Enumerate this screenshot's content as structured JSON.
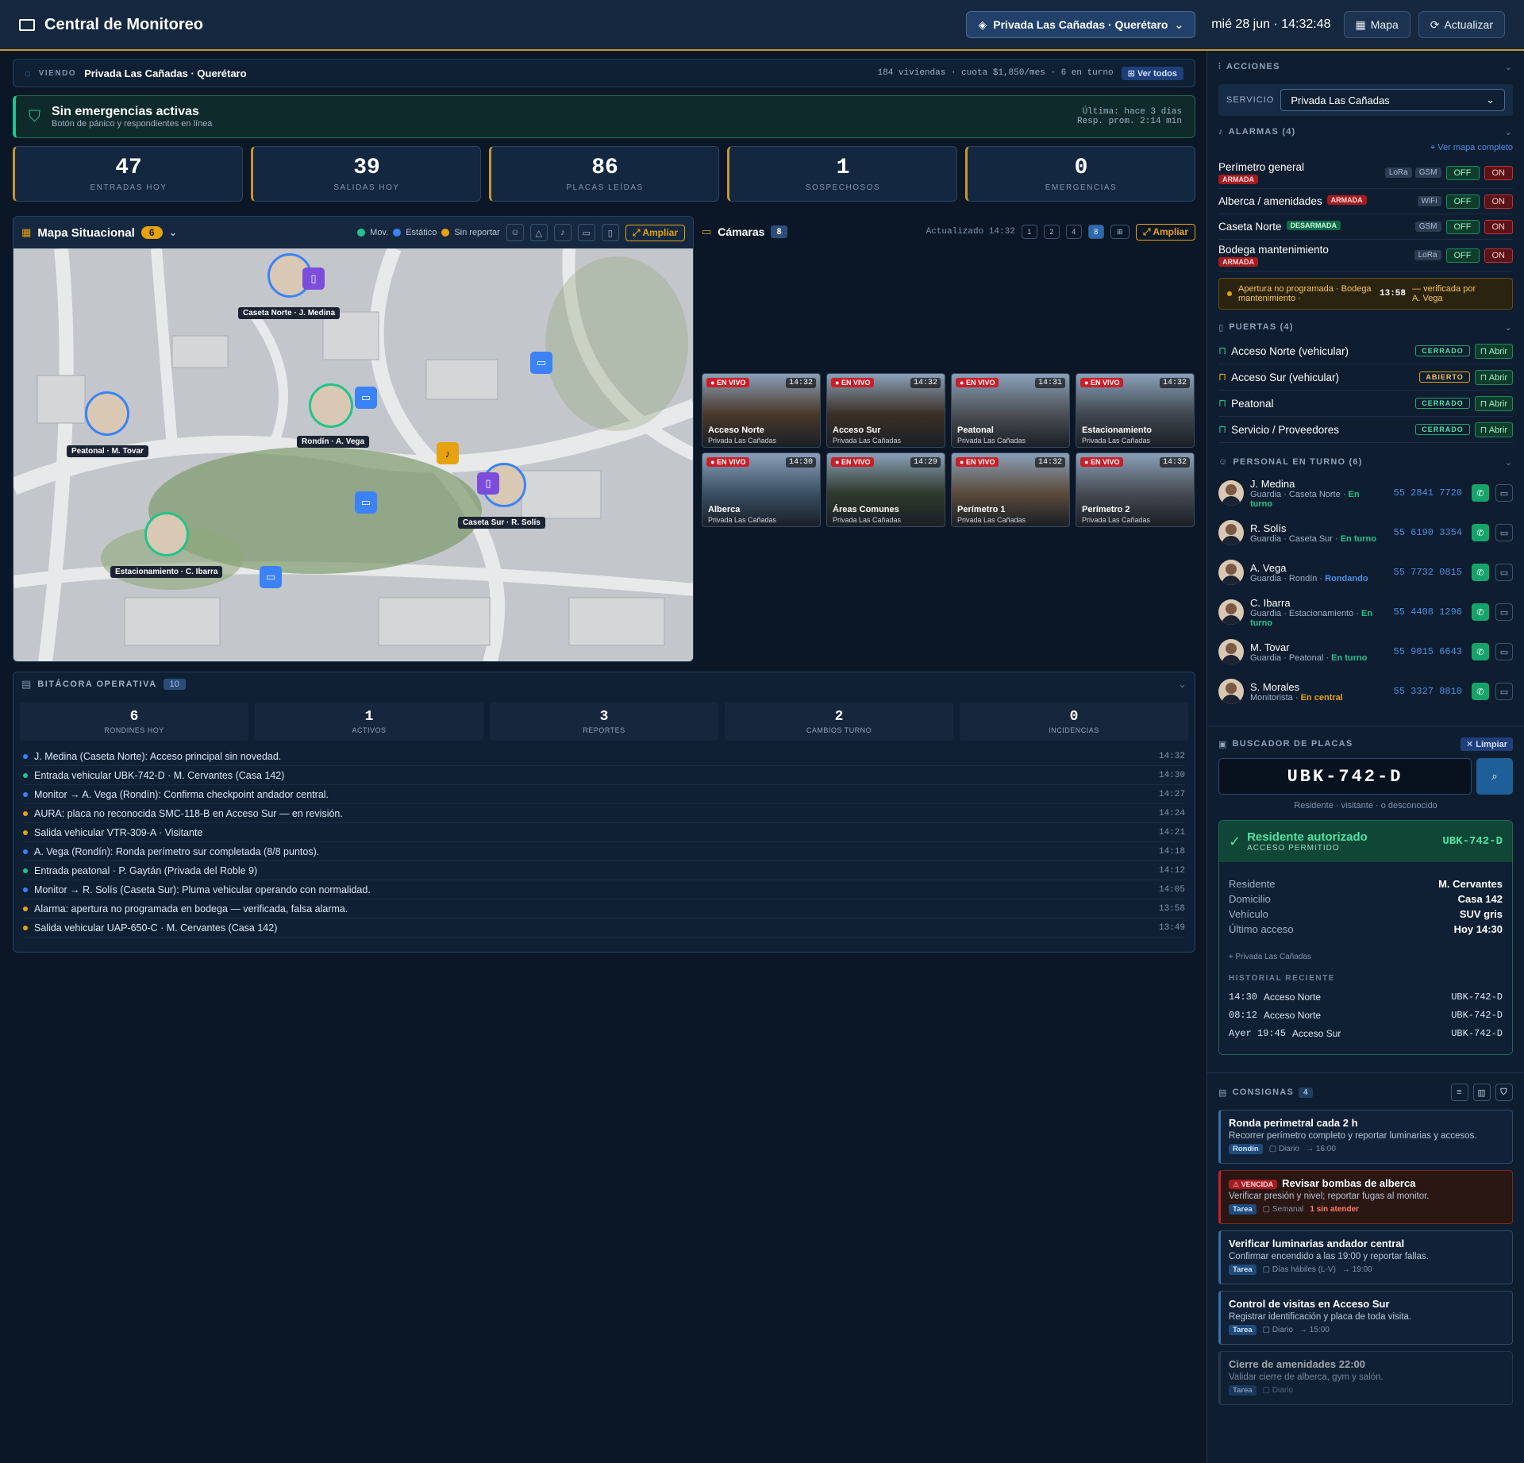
{
  "app": {
    "title": "Central de Monitoreo",
    "site_selector": "Privada Las Cañadas · Querétaro",
    "datetime": "mié 28 jun · 14:32:48",
    "map_button": "Mapa",
    "refresh_button": "Actualizar"
  },
  "viendo": {
    "label": "VIENDO",
    "site": "Privada Las Cañadas · Querétaro",
    "info": "184 viviendas · cuota $1,850/mes · 6 en turno",
    "ver_todos": "Ver todos"
  },
  "emergency": {
    "title": "Sin emergencias activas",
    "subtitle": "Botón de pánico y respondientes en línea",
    "last": "Última: hace 3 días",
    "resp": "Resp. prom. 2:14 min"
  },
  "stats": [
    {
      "value": "47",
      "label": "ENTRADAS HOY"
    },
    {
      "value": "39",
      "label": "SALIDAS HOY"
    },
    {
      "value": "86",
      "label": "PLACAS LEÍDAS"
    },
    {
      "value": "1",
      "label": "SOSPECHOSOS"
    },
    {
      "value": "0",
      "label": "EMERGENCIAS"
    }
  ],
  "map": {
    "title": "Mapa Situacional",
    "count": "6",
    "legend": [
      "Mov.",
      "Estático",
      "Sin reportar"
    ],
    "ampliar": "Ampliar",
    "markers": [
      "Caseta Norte · J. Medina",
      "Peatonal · M. Tovar",
      "Rondín · A. Vega",
      "Caseta Sur · R. Solís",
      "Estacionamiento · C. Ibarra"
    ]
  },
  "cameras": {
    "title": "Cámaras",
    "count": "8",
    "updated": "Actualizado 14:32",
    "layouts": [
      "1",
      "2",
      "4",
      "8",
      "⊞"
    ],
    "ampliar": "Ampliar",
    "live": "EN VIVO",
    "items": [
      {
        "name": "Acceso Norte",
        "site": "Privada Las Cañadas",
        "time": "14:32"
      },
      {
        "name": "Acceso Sur",
        "site": "Privada Las Cañadas",
        "time": "14:32"
      },
      {
        "name": "Peatonal",
        "site": "Privada Las Cañadas",
        "time": "14:31"
      },
      {
        "name": "Estacionamiento",
        "site": "Privada Las Cañadas",
        "time": "14:32"
      },
      {
        "name": "Alberca",
        "site": "Privada Las Cañadas",
        "time": "14:30"
      },
      {
        "name": "Áreas Comunes",
        "site": "Privada Las Cañadas",
        "time": "14:29"
      },
      {
        "name": "Perímetro 1",
        "site": "Privada Las Cañadas",
        "time": "14:32"
      },
      {
        "name": "Perímetro 2",
        "site": "Privada Las Cañadas",
        "time": "14:32"
      }
    ]
  },
  "bitacora": {
    "title": "BITÁCORA OPERATIVA",
    "count": "10",
    "stats": [
      {
        "value": "6",
        "label": "RONDINES HOY"
      },
      {
        "value": "1",
        "label": "ACTIVOS"
      },
      {
        "value": "3",
        "label": "REPORTES"
      },
      {
        "value": "2",
        "label": "CAMBIOS TURNO"
      },
      {
        "value": "0",
        "label": "INCIDENCIAS"
      }
    ],
    "entries": [
      {
        "text": "J. Medina (Caseta Norte): Acceso principal sin novedad.",
        "time": "14:32",
        "color": "#3b82f6"
      },
      {
        "text": "Entrada vehicular UBK-742-D · M. Cervantes (Casa 142)",
        "time": "14:30",
        "color": "#22c38a"
      },
      {
        "text": "Monitor → A. Vega (Rondín): Confirma checkpoint andador central.",
        "time": "14:27",
        "color": "#3b82f6"
      },
      {
        "text": "AURA: placa no reconocida SMC-118-B en Acceso Sur — en revisión.",
        "time": "14:24",
        "color": "#e6a20f"
      },
      {
        "text": "Salida vehicular VTR-309-A · Visitante",
        "time": "14:21",
        "color": "#e6a20f"
      },
      {
        "text": "A. Vega (Rondín): Ronda perímetro sur completada (8/8 puntos).",
        "time": "14:18",
        "color": "#3b82f6"
      },
      {
        "text": "Entrada peatonal · P. Gaytán (Privada del Roble 9)",
        "time": "14:12",
        "color": "#22c38a"
      },
      {
        "text": "Monitor → R. Solís (Caseta Sur): Pluma vehicular operando con normalidad.",
        "time": "14:05",
        "color": "#3b82f6"
      },
      {
        "text": "Alarma: apertura no programada en bodega — verificada, falsa alarma.",
        "time": "13:58",
        "color": "#e6a20f"
      },
      {
        "text": "Salida vehicular UAP-650-C · M. Cervantes (Casa 142)",
        "time": "13:49",
        "color": "#e6a20f"
      }
    ]
  },
  "actions": {
    "title": "ACCIONES",
    "service_label": "SERVICIO",
    "service_value": "Privada Las Cañadas"
  },
  "alarms": {
    "title": "ALARMAS (4)",
    "map_link": "Ver mapa completo",
    "off": "OFF",
    "on": "ON",
    "items": [
      {
        "name": "Perímetro general",
        "state": "ARMADA",
        "chips": [
          "LoRa",
          "GSM"
        ]
      },
      {
        "name": "Alberca / amenidades",
        "state": "ARMADA",
        "chips": [
          "WiFi"
        ]
      },
      {
        "name": "Caseta Norte",
        "state": "DESARMADA",
        "chips": [
          "GSM"
        ]
      },
      {
        "name": "Bodega mantenimiento",
        "state": "ARMADA",
        "chips": [
          "LoRa"
        ]
      }
    ],
    "notice": "Apertura no programada · Bodega mantenimiento ·",
    "notice_time": "13:58",
    "notice_right": "— verificada por A. Vega"
  },
  "doors": {
    "title": "PUERTAS (4)",
    "open_label": "Abrir",
    "items": [
      {
        "name": "Acceso Norte (vehicular)",
        "state": "CERRADO"
      },
      {
        "name": "Acceso Sur (vehicular)",
        "state": "ABIERTO"
      },
      {
        "name": "Peatonal",
        "state": "CERRADO"
      },
      {
        "name": "Servicio / Proveedores",
        "state": "CERRADO"
      }
    ]
  },
  "staff": {
    "title": "PERSONAL EN TURNO (6)",
    "items": [
      {
        "name": "J. Medina",
        "role": "Guardia · Caseta Norte ·",
        "status": "En turno",
        "phone": "55 2841 7720",
        "status_color": "#22c38a"
      },
      {
        "name": "R. Solís",
        "role": "Guardia · Caseta Sur ·",
        "status": "En turno",
        "phone": "55 6190 3354",
        "status_color": "#22c38a"
      },
      {
        "name": "A. Vega",
        "role": "Guardia · Rondín ·",
        "status": "Rondando",
        "phone": "55 7732 0815",
        "status_color": "#4a90e2"
      },
      {
        "name": "C. Ibarra",
        "role": "Guardia · Estacionamiento ·",
        "status": "En turno",
        "phone": "55 4408 1296",
        "status_color": "#22c38a"
      },
      {
        "name": "M. Tovar",
        "role": "Guardia · Peatonal ·",
        "status": "En turno",
        "phone": "55 9015 6643",
        "status_color": "#22c38a"
      },
      {
        "name": "S. Morales",
        "role": "Monitorista ·",
        "status": "En central",
        "phone": "55 3327 8810",
        "status_color": "#e6a20f"
      }
    ]
  },
  "plates": {
    "title": "BUSCADOR DE PLACAS",
    "clear": "Limpiar",
    "query": "UBK-742-D",
    "hint": "Residente · visitante · o desconocido",
    "result_title": "Residente autorizado",
    "result_sub": "ACCESO PERMITIDO",
    "result_plate": "UBK-742-D",
    "fields": [
      {
        "k": "Residente",
        "v": "M. Cervantes"
      },
      {
        "k": "Domicilio",
        "v": "Casa 142"
      },
      {
        "k": "Vehículo",
        "v": "SUV gris"
      },
      {
        "k": "Último acceso",
        "v": "Hoy 14:30"
      }
    ],
    "site": "Privada Las Cañadas",
    "history_title": "HISTORIAL RECIENTE",
    "history": [
      {
        "time": "14:30",
        "place": "Acceso Norte",
        "plate": "UBK-742-D"
      },
      {
        "time": "08:12",
        "place": "Acceso Norte",
        "plate": "UBK-742-D"
      },
      {
        "time": "Ayer 19:45",
        "place": "Acceso Sur",
        "plate": "UBK-742-D"
      }
    ]
  },
  "consignas": {
    "title": "CONSIGNAS",
    "count": "4",
    "items": [
      {
        "title": "Ronda perimetral cada 2 h",
        "desc": "Recorrer perímetro completo y reportar luminarias y accesos.",
        "type": "Rondín",
        "freq": "Diario",
        "extra": "→ 16:00",
        "overdue": ""
      },
      {
        "title": "Revisar bombas de alberca",
        "desc": "Verificar presión y nivel; reportar fugas al monitor.",
        "type": "Tarea",
        "freq": "Semanal",
        "extra": "1 sin atender",
        "overdue": "VENCIDA"
      },
      {
        "title": "Verificar luminarias andador central",
        "desc": "Confirmar encendido a las 19:00 y reportar fallas.",
        "type": "Tarea",
        "freq": "Días hábiles (L-V)",
        "extra": "→ 19:00",
        "overdue": ""
      },
      {
        "title": "Control de visitas en Acceso Sur",
        "desc": "Registrar identificación y placa de toda visita.",
        "type": "Tarea",
        "freq": "Diario",
        "extra": "→ 15:00",
        "overdue": ""
      },
      {
        "title": "Cierre de amenidades 22:00",
        "desc": "Validar cierre de alberca, gym y salón.",
        "type": "Tarea",
        "freq": "Diario",
        "extra": "",
        "overdue": ""
      }
    ]
  }
}
